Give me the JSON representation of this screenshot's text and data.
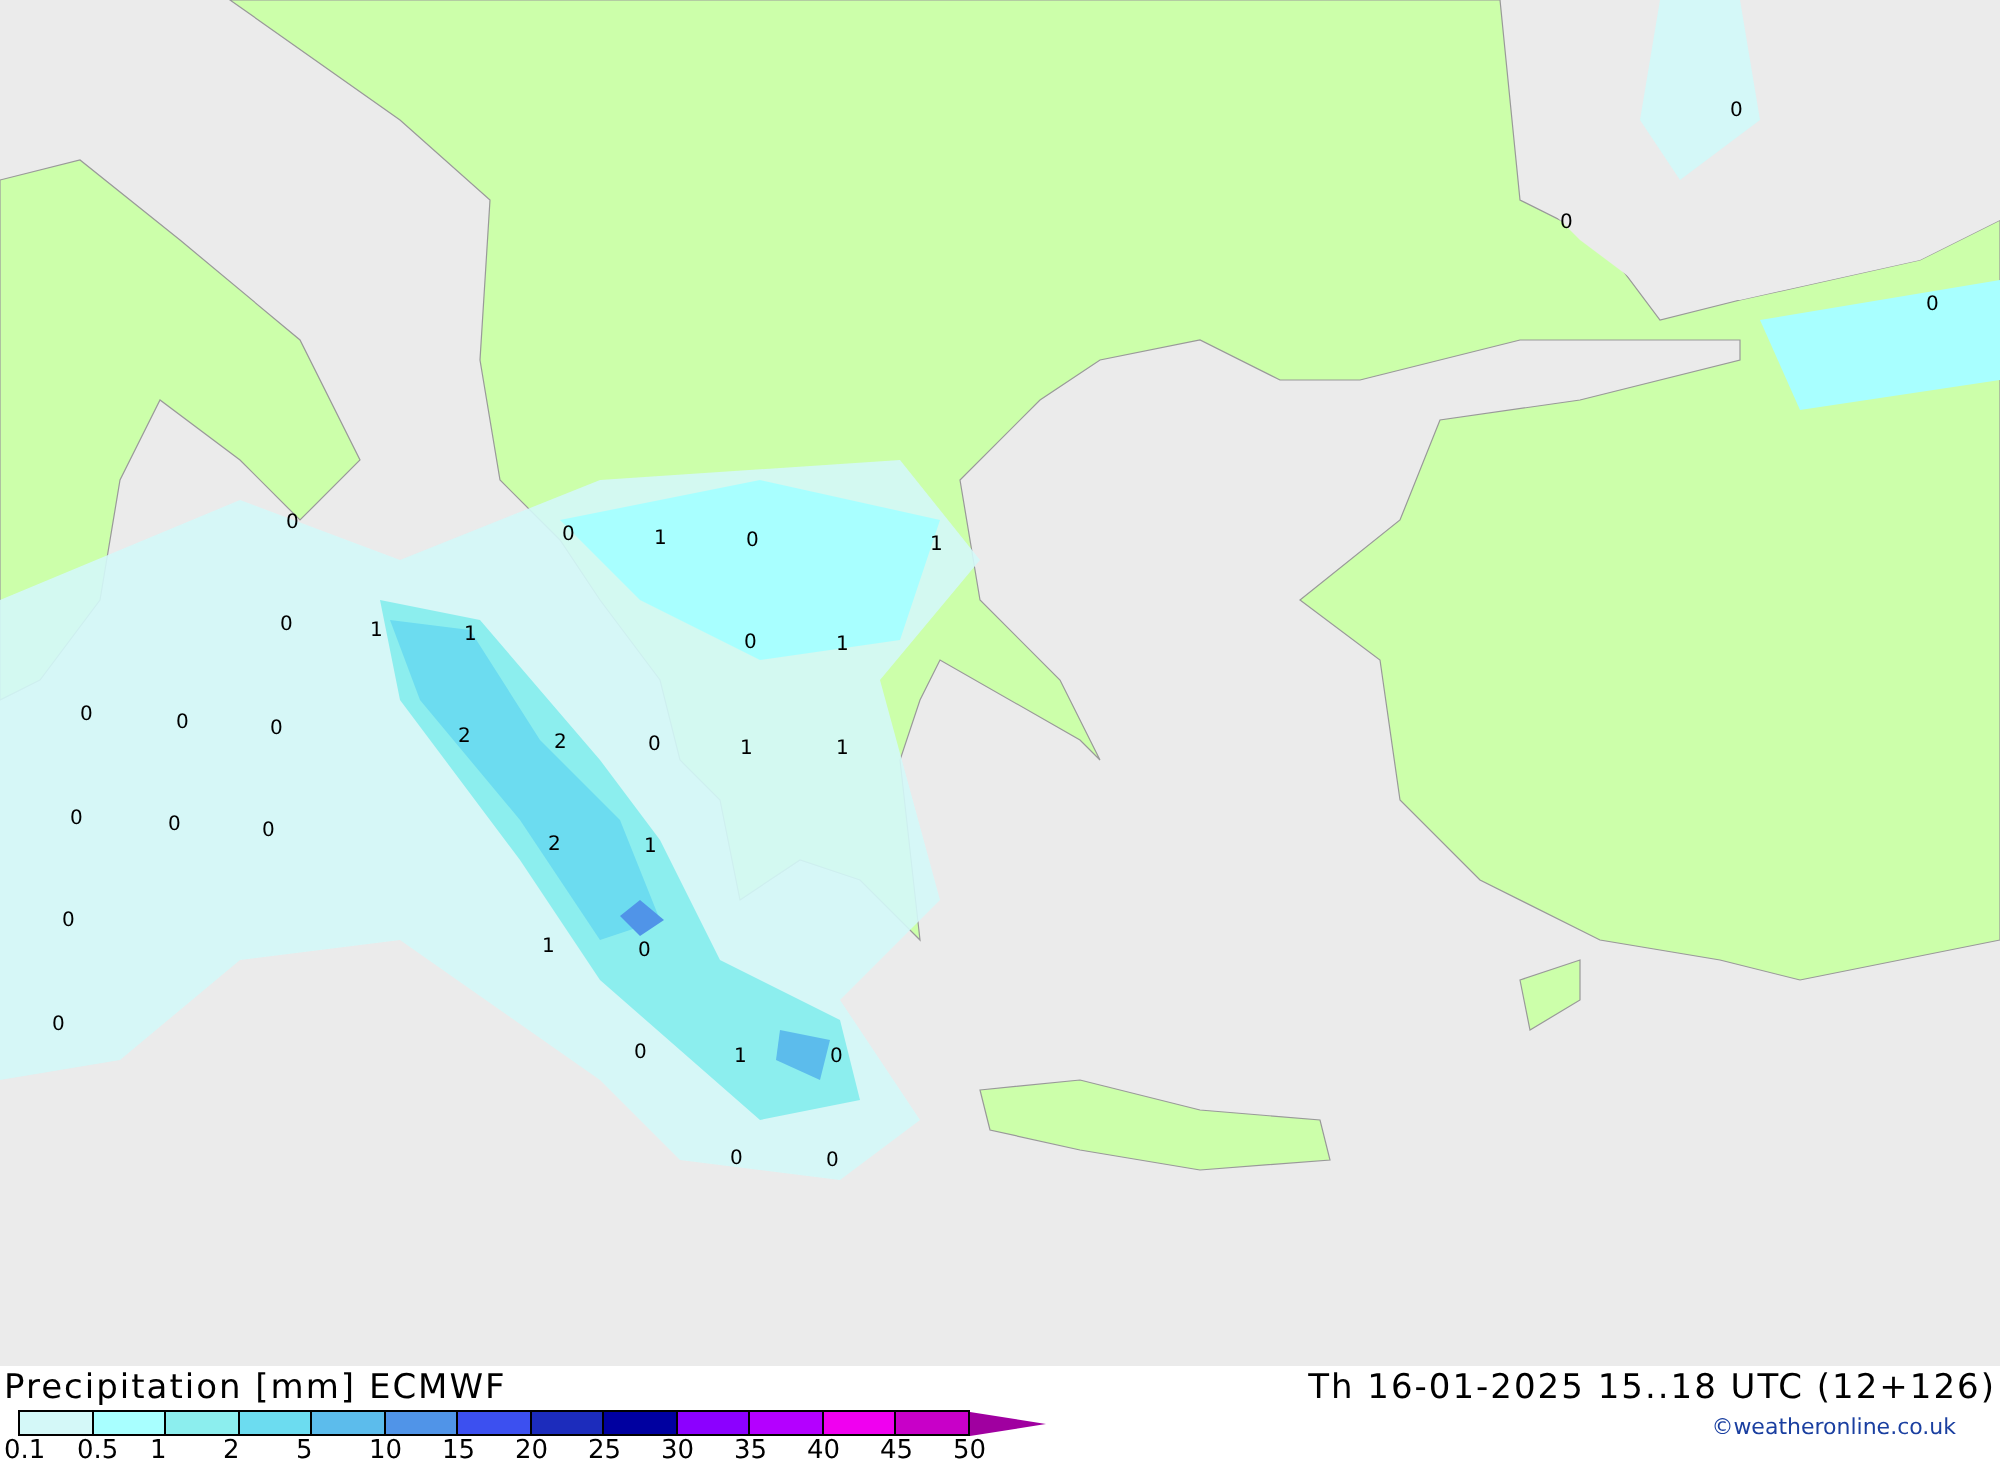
{
  "map": {
    "labels": [
      {
        "text": "0"
      },
      {
        "text": "0"
      },
      {
        "text": "0"
      },
      {
        "text": "0"
      },
      {
        "text": "0"
      },
      {
        "text": "1"
      },
      {
        "text": "0"
      },
      {
        "text": "1"
      },
      {
        "text": "0"
      },
      {
        "text": "1"
      },
      {
        "text": "1"
      },
      {
        "text": "0"
      },
      {
        "text": "1"
      },
      {
        "text": "0"
      },
      {
        "text": "0"
      },
      {
        "text": "0"
      },
      {
        "text": "2"
      },
      {
        "text": "2"
      },
      {
        "text": "0"
      },
      {
        "text": "1"
      },
      {
        "text": "1"
      },
      {
        "text": "0"
      },
      {
        "text": "0"
      },
      {
        "text": "0"
      },
      {
        "text": "2"
      },
      {
        "text": "1"
      },
      {
        "text": "0"
      },
      {
        "text": "1"
      },
      {
        "text": "0"
      },
      {
        "text": "0"
      },
      {
        "text": "0"
      },
      {
        "text": "1"
      },
      {
        "text": "0"
      },
      {
        "text": "0"
      },
      {
        "text": "0"
      }
    ]
  },
  "legend": {
    "title": "Precipitation [mm] ECMWF",
    "swatches": [
      {
        "color": "#d4f8f8"
      },
      {
        "color": "#a8ffff"
      },
      {
        "color": "#8ceeee"
      },
      {
        "color": "#6cdcf0"
      },
      {
        "color": "#5cbcec"
      },
      {
        "color": "#5094e8"
      },
      {
        "color": "#3c50f0"
      },
      {
        "color": "#1c2cbc"
      },
      {
        "color": "#0000a0"
      },
      {
        "color": "#8c00ff"
      },
      {
        "color": "#b400ff"
      },
      {
        "color": "#f000f0"
      },
      {
        "color": "#c800c8"
      }
    ],
    "ticks": [
      "0.1",
      "0.5",
      "1",
      "2",
      "5",
      "10",
      "15",
      "20",
      "25",
      "30",
      "35",
      "40",
      "45",
      "50"
    ],
    "valid_time": "Th 16-01-2025 15..18 UTC (12+126)",
    "credit": "©weatheronline.co.uk"
  }
}
